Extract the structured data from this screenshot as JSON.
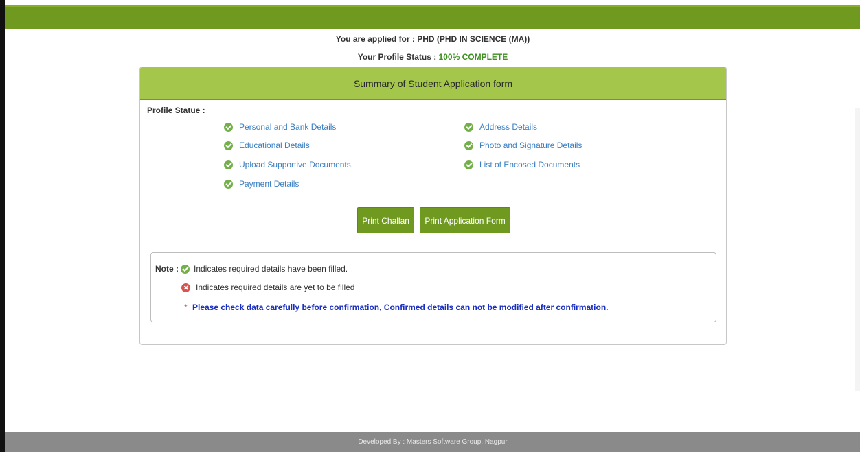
{
  "header": {
    "applied_text": "You are applied for : PHD (PHD IN SCIENCE (MA))",
    "profile_status_label": "Your Profile Status :",
    "profile_status_value": "100% COMPLETE"
  },
  "panel": {
    "title": "Summary of Student Application form",
    "profile_label": "Profile Statue :",
    "items": [
      {
        "label": "Personal and Bank Details",
        "status_icon": "check-circle-icon"
      },
      {
        "label": "Address Details",
        "status_icon": "check-circle-icon"
      },
      {
        "label": "Educational Details",
        "status_icon": "check-circle-icon"
      },
      {
        "label": "Photo and Signature Details",
        "status_icon": "check-circle-icon"
      },
      {
        "label": "Upload Supportive Documents",
        "status_icon": "check-circle-icon"
      },
      {
        "label": "List of Encosed Documents",
        "status_icon": "check-circle-icon"
      },
      {
        "label": "Payment Details",
        "status_icon": "check-circle-icon"
      }
    ],
    "buttons": {
      "print_challan": "Print Challan",
      "print_application": "Print Application Form"
    }
  },
  "note": {
    "label": "Note :",
    "filled_text": "Indicates required details have been filled.",
    "pending_text": "Indicates required details are yet to be filled",
    "warning_star": "*",
    "warning_text": "Please check data carefully before confirmation, Confirmed details can not be modified after confirmation."
  },
  "footer": {
    "text": "Developed By : Masters Software Group, Nagpur"
  },
  "colors": {
    "brand_green": "#6f9a1f",
    "header_green": "#a4c64a",
    "link_blue": "#3a7fc1",
    "status_green": "#3d8f1f",
    "warning_blue": "#1a2fbf"
  }
}
